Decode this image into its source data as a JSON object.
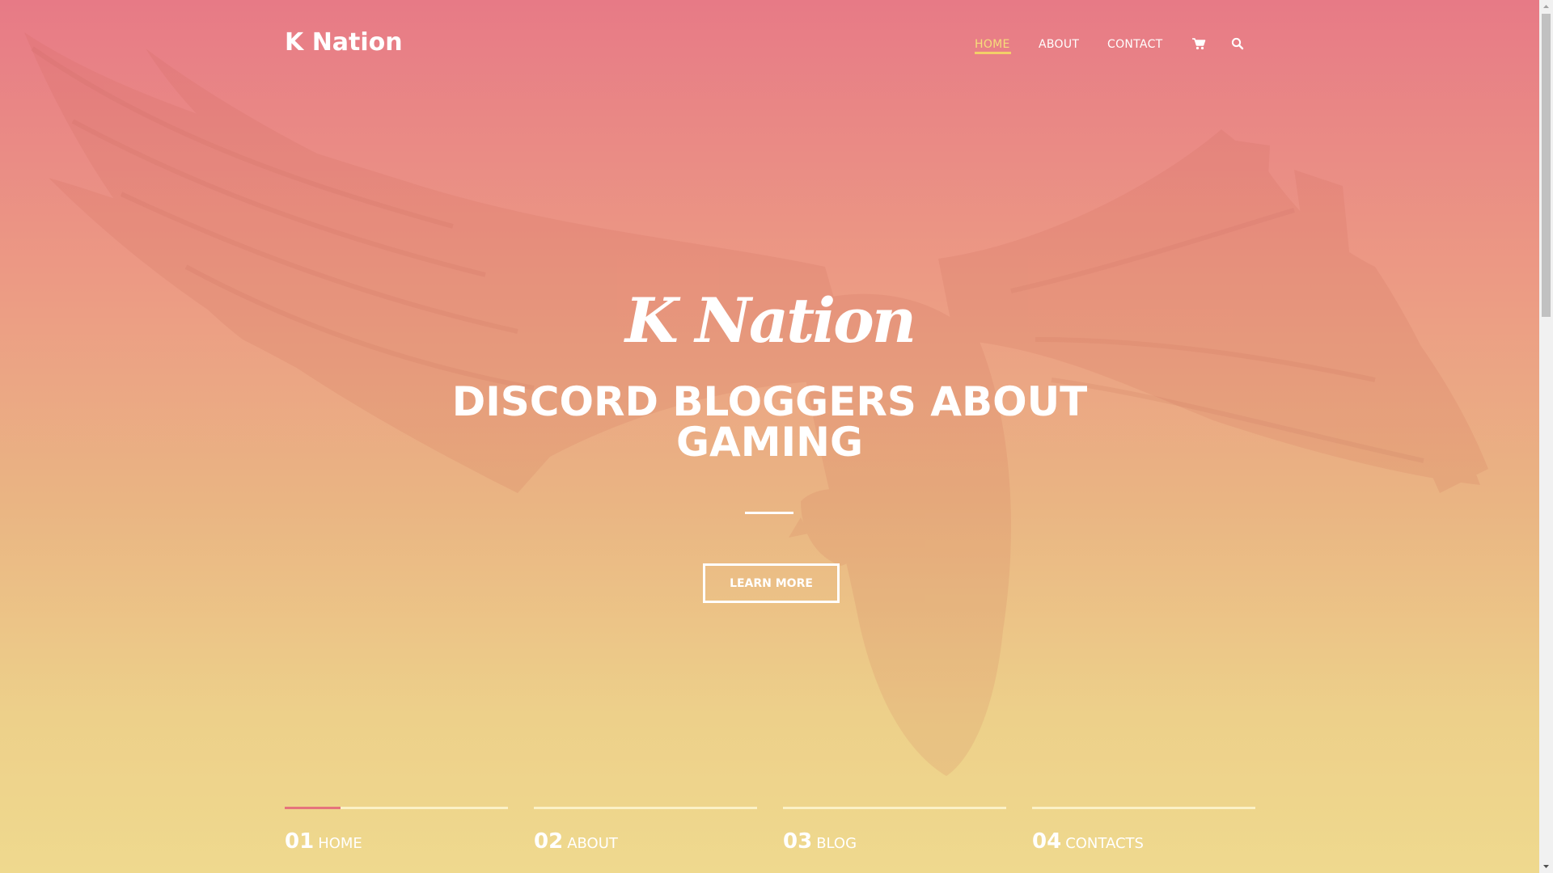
{
  "site": {
    "logo": "K Nation"
  },
  "nav": {
    "items": [
      {
        "label": "HOME",
        "active": true
      },
      {
        "label": "ABOUT",
        "active": false
      },
      {
        "label": "CONTACT",
        "active": false
      }
    ],
    "icons": [
      "cart-icon",
      "search-icon"
    ]
  },
  "hero": {
    "script_title": "K Nation",
    "headline_line1": "DISCORD BLOGGERS ABOUT",
    "headline_line2": "GAMING",
    "button_label": "LEARN MORE",
    "background_image": "eagle-in-flight"
  },
  "sections": [
    {
      "number": "01",
      "label": "HOME",
      "progress": 0.25
    },
    {
      "number": "02",
      "label": "ABOUT",
      "progress": 0
    },
    {
      "number": "03",
      "label": "BLOG",
      "progress": 0
    },
    {
      "number": "04",
      "label": "CONTACTS",
      "progress": 0
    }
  ],
  "colors": {
    "gradient_top": "#e77a86",
    "gradient_bottom": "#efd98e",
    "nav_active": "#f7de7a",
    "progress_accent": "#e5737c",
    "text": "#ffffff"
  }
}
